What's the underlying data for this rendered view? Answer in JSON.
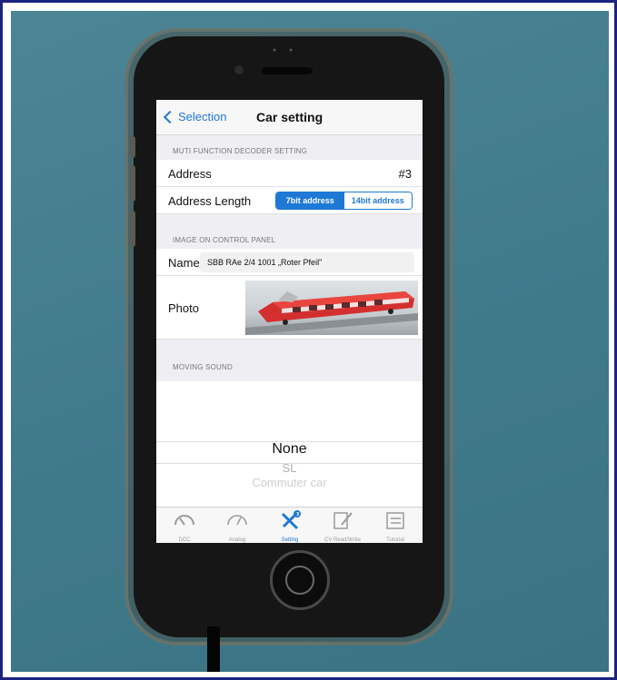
{
  "nav": {
    "back_label": "Selection",
    "title": "Car setting"
  },
  "sections": {
    "decoder": "MUTI FUNCTION DECODER SETTING",
    "image": "IMAGE ON CONTROL PANEL",
    "sound": "MOVING SOUND"
  },
  "address": {
    "label": "Address",
    "value": "#3"
  },
  "address_length": {
    "label": "Address Length",
    "option_7bit": "7bit address",
    "option_14bit": "14bit address"
  },
  "name": {
    "label": "Name",
    "value": "SBB RAe 2/4 1001 „Roter Pfeil\""
  },
  "photo": {
    "label": "Photo"
  },
  "sound_picker": {
    "selected": "None",
    "next": "SL",
    "after": "Commuter car"
  },
  "tabs": [
    {
      "label": "DCC",
      "icon": "dcc-gauge-icon"
    },
    {
      "label": "Analog",
      "icon": "analog-gauge-icon"
    },
    {
      "label": "Setting",
      "icon": "wrench-screwdriver-icon"
    },
    {
      "label": "CV Read/Write",
      "icon": "pencil-note-icon"
    },
    {
      "label": "Tutorial",
      "icon": "checklist-icon"
    }
  ],
  "colors": {
    "accent": "#1e78d6",
    "background": "#3f7a8b",
    "train": "#d32f2f"
  }
}
